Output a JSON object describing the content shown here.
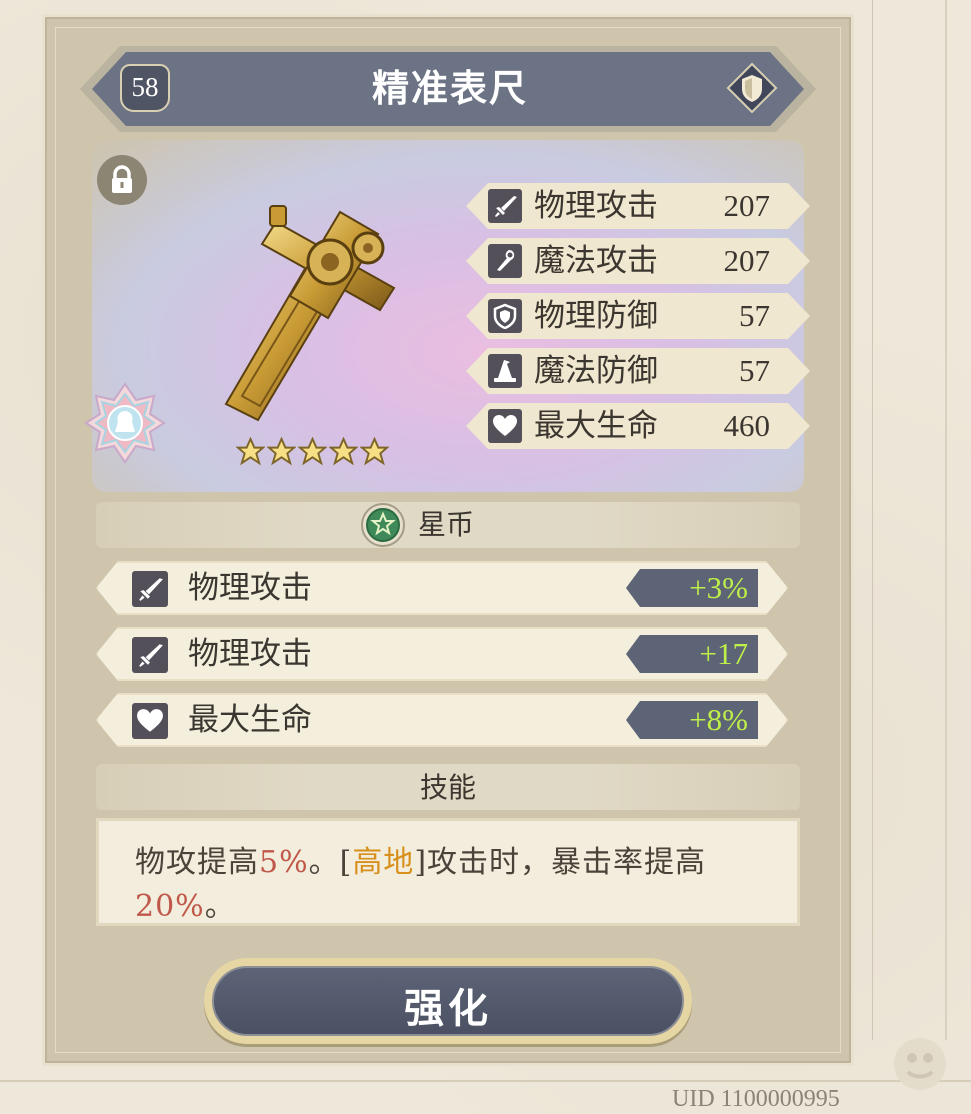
{
  "item": {
    "level": "58",
    "name": "精准表尺",
    "stars": 5
  },
  "stats": [
    {
      "icon": "sword-icon",
      "label": "物理攻击",
      "value": "207"
    },
    {
      "icon": "staff-icon",
      "label": "魔法攻击",
      "value": "207"
    },
    {
      "icon": "shield-icon",
      "label": "物理防御",
      "value": "57"
    },
    {
      "icon": "wizard-hat-icon",
      "label": "魔法防御",
      "value": "57"
    },
    {
      "icon": "heart-icon",
      "label": "最大生命",
      "value": "460"
    }
  ],
  "sub_section": {
    "label": "星币",
    "icon": "star-coin-icon"
  },
  "sub_stats": [
    {
      "icon": "sword-icon",
      "label": "物理攻击",
      "value": "+3%"
    },
    {
      "icon": "sword-icon",
      "label": "物理攻击",
      "value": "+17"
    },
    {
      "icon": "heart-icon",
      "label": "最大生命",
      "value": "+8%"
    }
  ],
  "skill": {
    "title": "技能",
    "text_parts": {
      "p1": "物攻提高",
      "v1": "5%",
      "p2": "。[",
      "tag": "高地",
      "p3": "]攻击时，暴击率提高",
      "v2": "20%",
      "p4": "。"
    }
  },
  "actions": {
    "enhance_label": "强化"
  },
  "footer": {
    "uid": "UID 1100000995"
  },
  "colors": {
    "header": "#6c7384",
    "bonus_text": "#bff04a",
    "highlight_value": "#c0584a",
    "highlight_tag": "#d8901c"
  }
}
